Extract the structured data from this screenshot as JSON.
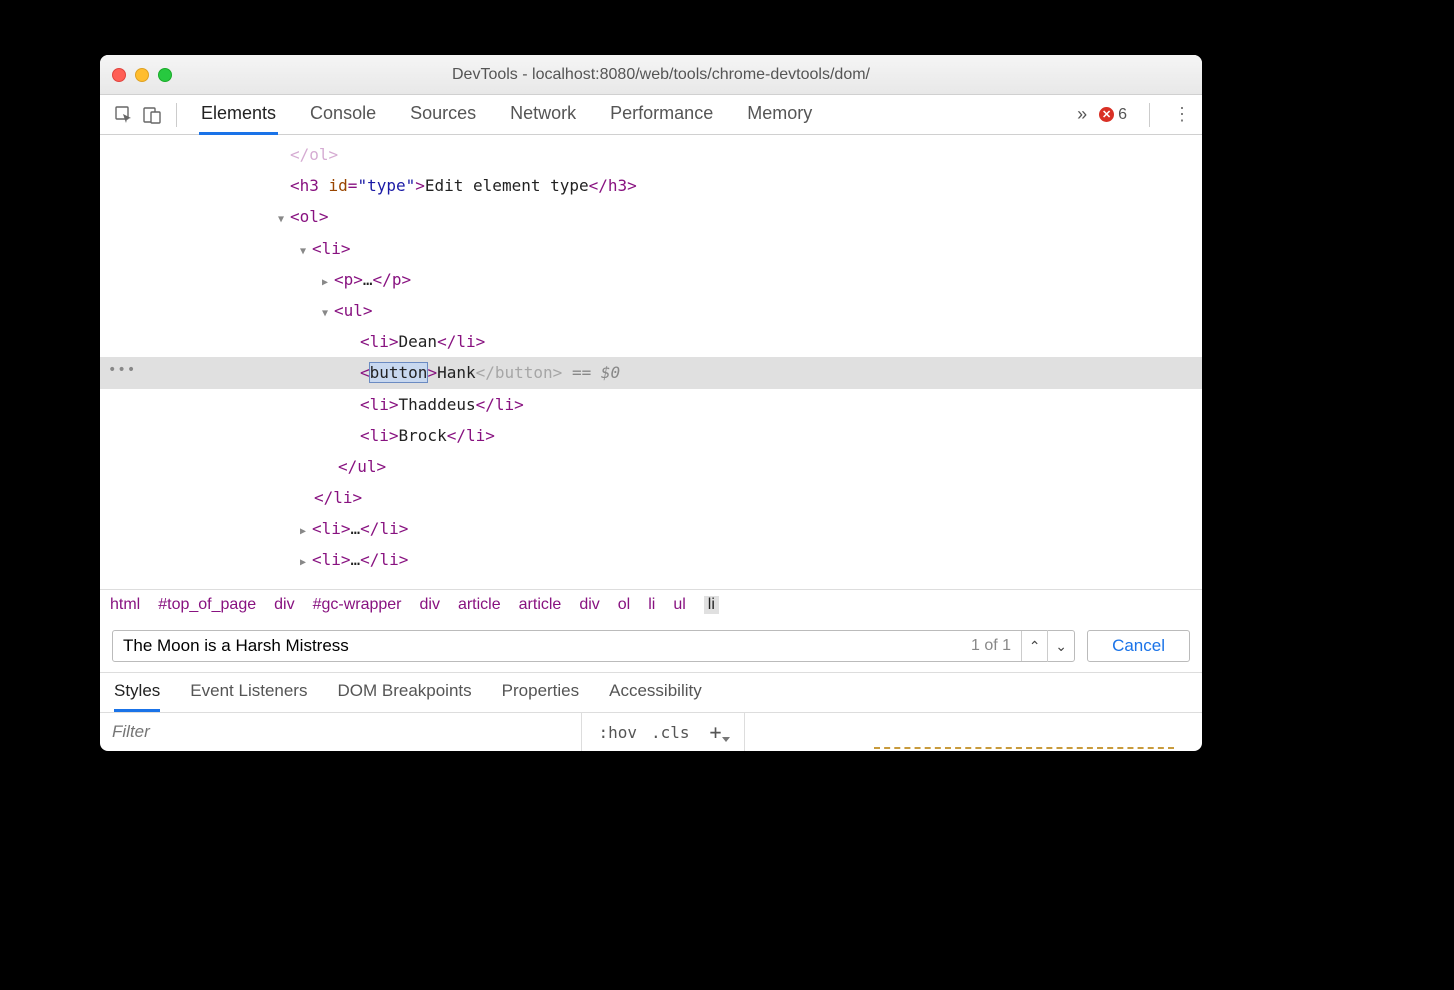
{
  "window": {
    "title": "DevTools - localhost:8080/web/tools/chrome-devtools/dom/"
  },
  "toolbar": {
    "tabs": [
      "Elements",
      "Console",
      "Sources",
      "Network",
      "Performance",
      "Memory"
    ],
    "error_count": "6",
    "more_glyph": "»"
  },
  "dom": {
    "closing_ul": "</ol>",
    "h3_open_tag": "<h3 ",
    "h3_attr_name": "id",
    "h3_attr_value": "\"type\"",
    "h3_text": "Edit element type",
    "h3_close": "</h3>",
    "ol_open": "<ol>",
    "li_open": "<li>",
    "p_open": "<p>",
    "p_ellipsis": "…",
    "p_close": "</p>",
    "ul_open": "<ul>",
    "li_tag": "li",
    "items": {
      "0": "Dean",
      "1_edit_tag": "button",
      "1_text": "Hank",
      "1_close": "</button>",
      "1_hint": " == $0",
      "2": "Thaddeus",
      "3": "Brock"
    },
    "ul_close": "</ul>",
    "li_close": "</li>",
    "li_collapsed_open": "<li>",
    "li_collapsed_ell": "…",
    "li_collapsed_close": "</li>"
  },
  "breadcrumb": [
    "html",
    "#top_of_page",
    "div",
    "#gc-wrapper",
    "div",
    "article",
    "article",
    "div",
    "ol",
    "li",
    "ul",
    "li"
  ],
  "search": {
    "query": "The Moon is a Harsh Mistress",
    "count": "1 of 1",
    "cancel": "Cancel"
  },
  "subtabs": [
    "Styles",
    "Event Listeners",
    "DOM Breakpoints",
    "Properties",
    "Accessibility"
  ],
  "styles": {
    "filter_placeholder": "Filter",
    "hov": ":hov",
    "cls": ".cls",
    "plus": "+"
  }
}
